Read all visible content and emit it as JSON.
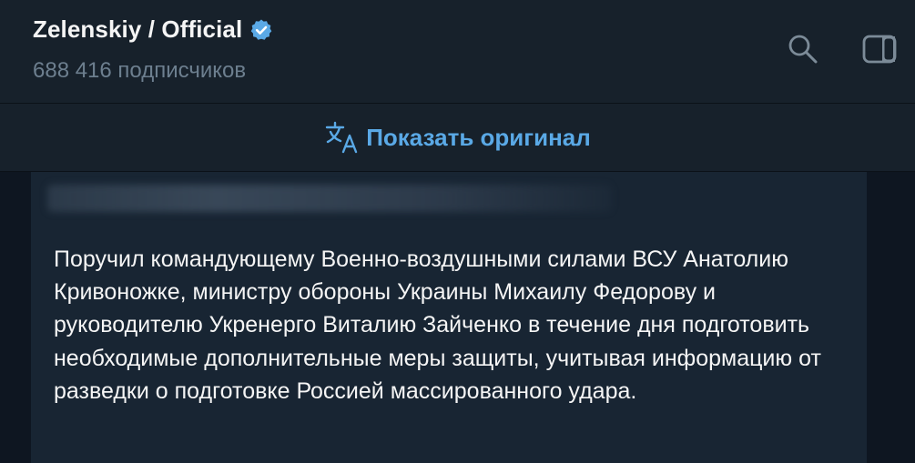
{
  "header": {
    "channel_name": "Zelenskiy / Official",
    "subscribers": "688 416 подписчиков",
    "verified_icon": "verified-badge-icon",
    "search_icon": "search-icon",
    "side_panel_icon": "side-panel-icon"
  },
  "translate_bar": {
    "label": "Показать оригинал",
    "icon": "translate-icon"
  },
  "message": {
    "text": "Поручил командующему Военно-воздушными силами ВСУ Анатолию Кривоножке, министру обороны Украины Михаилу Федорову и руководителю Укренерго Виталию Зайченко в течение дня подготовить необходимые дополнительные меры защиты, учитывая информацию от разведки о подготовке Россией массированного удара."
  },
  "colors": {
    "background": "#0e1621",
    "header_bg": "#17212b",
    "message_bg": "#182533",
    "accent": "#5aa9e6",
    "muted_text": "#6d7f8f"
  }
}
